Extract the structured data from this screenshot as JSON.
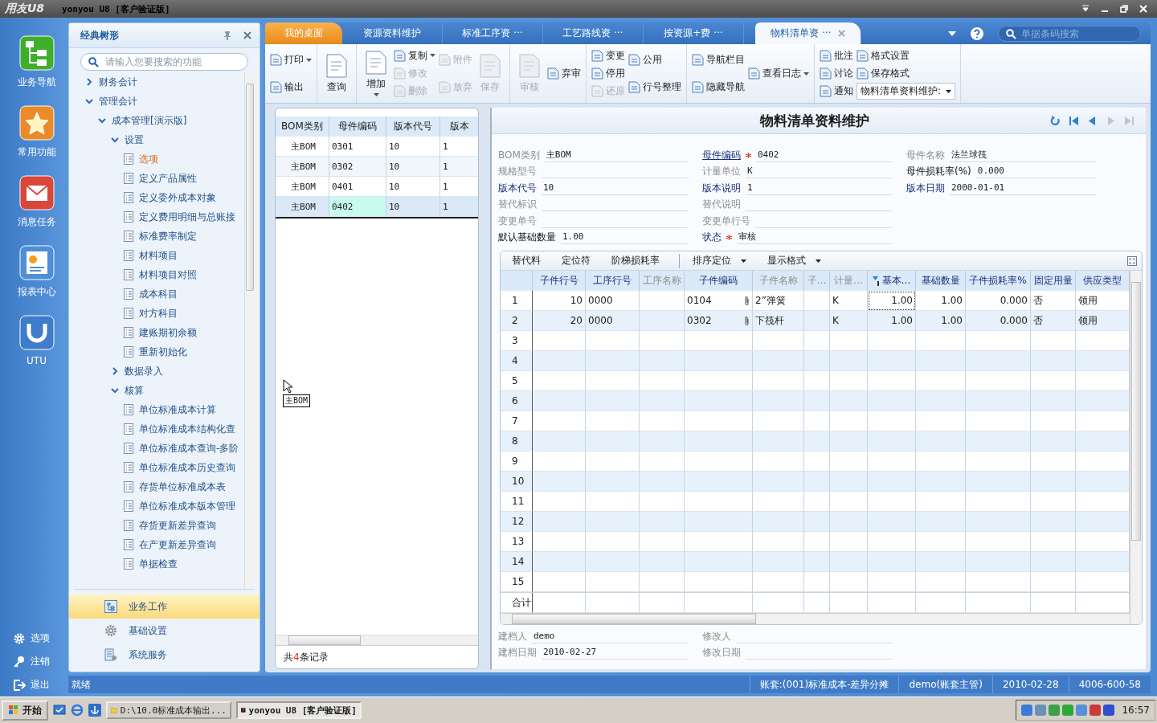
{
  "window": {
    "logo": "用友U8",
    "title": "yonyou U8 [客户验证版]"
  },
  "rail": {
    "items": [
      {
        "label": "业务导航"
      },
      {
        "label": "常用功能"
      },
      {
        "label": "消息任务"
      },
      {
        "label": "报表中心"
      },
      {
        "label": "UTU"
      }
    ],
    "bottom": [
      {
        "label": "选项"
      },
      {
        "label": "注销"
      },
      {
        "label": "退出"
      }
    ]
  },
  "tree_panel": {
    "title": "经典树形",
    "search": {
      "placeholder": "请输入您要搜索的功能"
    },
    "tree": [
      {
        "label": "财务会计",
        "kind": "folder",
        "expanded": false,
        "selected": false
      },
      {
        "label": "管理会计",
        "kind": "folder",
        "expanded": true,
        "selected": false,
        "children": [
          {
            "label": "成本管理[演示版]",
            "kind": "folder",
            "expanded": true,
            "selected": false,
            "children": [
              {
                "label": "设置",
                "kind": "folder",
                "expanded": true,
                "selected": false,
                "children": [
                  {
                    "label": "选项",
                    "kind": "leaf",
                    "selected": true
                  },
                  {
                    "label": "定义产品属性",
                    "kind": "leaf",
                    "selected": false
                  },
                  {
                    "label": "定义委外成本对象",
                    "kind": "leaf",
                    "selected": false
                  },
                  {
                    "label": "定义费用明细与总账接",
                    "kind": "leaf",
                    "selected": false
                  },
                  {
                    "label": "标准费率制定",
                    "kind": "leaf",
                    "selected": false
                  },
                  {
                    "label": "材料项目",
                    "kind": "leaf",
                    "selected": false
                  },
                  {
                    "label": "材料项目对照",
                    "kind": "leaf",
                    "selected": false
                  },
                  {
                    "label": "成本科目",
                    "kind": "leaf",
                    "selected": false
                  },
                  {
                    "label": "对方科目",
                    "kind": "leaf",
                    "selected": false
                  },
                  {
                    "label": "建账期初余额",
                    "kind": "leaf",
                    "selected": false
                  },
                  {
                    "label": "重新初始化",
                    "kind": "leaf",
                    "selected": false
                  }
                ]
              },
              {
                "label": "数据录入",
                "kind": "folder",
                "expanded": false,
                "selected": false
              },
              {
                "label": "核算",
                "kind": "folder",
                "expanded": true,
                "selected": false,
                "children": [
                  {
                    "label": "单位标准成本计算",
                    "kind": "leaf",
                    "selected": false
                  },
                  {
                    "label": "单位标准成本结构化查",
                    "kind": "leaf",
                    "selected": false
                  },
                  {
                    "label": "单位标准成本查询-多阶",
                    "kind": "leaf",
                    "selected": false
                  },
                  {
                    "label": "单位标准成本历史查询",
                    "kind": "leaf",
                    "selected": false
                  },
                  {
                    "label": "存货单位标准成本表",
                    "kind": "leaf",
                    "selected": false
                  },
                  {
                    "label": "单位标准成本版本管理",
                    "kind": "leaf",
                    "selected": false
                  },
                  {
                    "label": "存货更新差异查询",
                    "kind": "leaf",
                    "selected": false
                  },
                  {
                    "label": "在产更新差异查询",
                    "kind": "leaf",
                    "selected": false
                  },
                  {
                    "label": "单据检查",
                    "kind": "leaf",
                    "selected": false
                  }
                ]
              }
            ]
          }
        ]
      }
    ],
    "modules": [
      {
        "label": "业务工作",
        "selected": true
      },
      {
        "label": "基础设置",
        "selected": false
      },
      {
        "label": "系统服务",
        "selected": false
      }
    ]
  },
  "tabs": [
    {
      "label": "我的桌面",
      "kind": "home",
      "selected": false
    },
    {
      "label": "资源资料维护",
      "kind": "doc",
      "selected": false
    },
    {
      "label": "标准工序资 ···",
      "kind": "doc",
      "selected": false
    },
    {
      "label": "工艺路线资 ···",
      "kind": "doc",
      "selected": false
    },
    {
      "label": "按资源+费 ···",
      "kind": "doc",
      "selected": false
    },
    {
      "label": "物料清单资 ···",
      "kind": "doc",
      "selected": true
    }
  ],
  "barcode_search": {
    "placeholder": "单据条码搜索"
  },
  "toolbar": {
    "groups": [
      [
        [
          {
            "label": "打印",
            "kind": "small",
            "disabled": false,
            "dropdown": true
          },
          {
            "label": "输出",
            "kind": "small",
            "disabled": false,
            "dropdown": false
          }
        ]
      ],
      [
        [
          {
            "label": "查询",
            "kind": "large",
            "disabled": false,
            "dropdown": false
          }
        ]
      ],
      [
        [
          {
            "label": "增加",
            "kind": "large",
            "disabled": false,
            "dropdown": true
          }
        ],
        [
          {
            "label": "复制",
            "kind": "small",
            "disabled": false,
            "dropdown": true
          },
          {
            "label": "修改",
            "kind": "small",
            "disabled": true,
            "dropdown": false
          },
          {
            "label": "删除",
            "kind": "small",
            "disabled": true,
            "dropdown": false
          }
        ],
        [
          {
            "label": "附件",
            "kind": "small",
            "disabled": true,
            "dropdown": false
          },
          {
            "label": "放弃",
            "kind": "small",
            "disabled": true,
            "dropdown": false
          }
        ],
        [
          {
            "label": "保存",
            "kind": "large",
            "disabled": true,
            "dropdown": false
          }
        ]
      ],
      [
        [
          {
            "label": "审核",
            "kind": "large",
            "disabled": true,
            "dropdown": false
          }
        ],
        [
          {
            "label": "弃审",
            "kind": "small",
            "disabled": false,
            "dropdown": false
          }
        ]
      ],
      [
        [
          {
            "label": "变更",
            "kind": "small",
            "disabled": false,
            "dropdown": false
          },
          {
            "label": "停用",
            "kind": "small",
            "disabled": false,
            "dropdown": false
          },
          {
            "label": "还原",
            "kind": "small",
            "disabled": true,
            "dropdown": false
          }
        ],
        [
          {
            "label": "公用",
            "kind": "small",
            "disabled": false,
            "dropdown": false
          },
          {
            "label": "行号整理",
            "kind": "small",
            "disabled": false,
            "dropdown": false
          }
        ]
      ],
      [
        [
          {
            "label": "导航栏目",
            "kind": "small",
            "disabled": false,
            "dropdown": false
          },
          {
            "label": "隐藏导航",
            "kind": "small",
            "disabled": false,
            "dropdown": false
          }
        ],
        [
          {
            "label": "查看日志",
            "kind": "small",
            "disabled": false,
            "dropdown": true
          }
        ]
      ],
      [
        [
          {
            "label": "批注",
            "kind": "small",
            "disabled": false,
            "dropdown": false
          },
          {
            "label": "讨论",
            "kind": "small",
            "disabled": false,
            "dropdown": false
          },
          {
            "label": "通知",
            "kind": "small",
            "disabled": false,
            "dropdown": false
          }
        ],
        [
          {
            "label": "格式设置",
            "kind": "small",
            "disabled": false,
            "dropdown": false
          },
          {
            "label": "保存格式",
            "kind": "small",
            "disabled": false,
            "dropdown": false
          },
          {
            "label": "物料清单资料维护:",
            "kind": "select",
            "dropdown": true
          }
        ]
      ]
    ]
  },
  "bom_list": {
    "columns": [
      "BOM类别",
      "母件编码",
      "版本代号",
      "版本"
    ],
    "rows": [
      {
        "cells": [
          "主BOM",
          "0301",
          "10",
          "1"
        ],
        "selected": false
      },
      {
        "cells": [
          "主BOM",
          "0302",
          "10",
          "1"
        ],
        "selected": false
      },
      {
        "cells": [
          "主BOM",
          "0401",
          "10",
          "1"
        ],
        "selected": false
      },
      {
        "cells": [
          "主BOM",
          "0402",
          "10",
          "1"
        ],
        "selected": true
      }
    ],
    "drag_tooltip": "主BOM",
    "footer": "共**4**条记录"
  },
  "form": {
    "title": "物料清单资料维护",
    "record_nav": [
      {
        "kind": "refresh",
        "disabled": false
      },
      {
        "kind": "first",
        "disabled": false
      },
      {
        "kind": "prev",
        "disabled": false
      },
      {
        "kind": "next",
        "disabled": true
      },
      {
        "kind": "last",
        "disabled": true
      }
    ],
    "columns": [
      [
        {
          "label": "BOM类别",
          "kind": "readonly",
          "required": false,
          "value": "主BOM"
        },
        {
          "label": "规格型号",
          "kind": "readonly",
          "required": false
        },
        {
          "label": "版本代号",
          "kind": "key",
          "required": false,
          "value": "10"
        },
        {
          "label": "替代标识",
          "kind": "readonly",
          "required": false
        },
        {
          "label": "变更单号",
          "kind": "readonly",
          "required": false
        },
        {
          "label": "默认基础数量",
          "kind": "editable",
          "required": false,
          "value": "1.00"
        }
      ],
      [
        {
          "label": "母件编码",
          "kind": "link",
          "required": true,
          "value": "0402"
        },
        {
          "label": "计量单位",
          "kind": "readonly",
          "required": false,
          "value": "K"
        },
        {
          "label": "版本说明",
          "kind": "key",
          "required": false,
          "value": "1"
        },
        {
          "label": "替代说明",
          "kind": "readonly",
          "required": false
        },
        {
          "label": "变更单行号",
          "kind": "readonly",
          "required": false
        },
        {
          "label": "状态",
          "kind": "key",
          "required": true,
          "value": "审核"
        }
      ],
      [
        {
          "label": "母件名称",
          "kind": "readonly",
          "required": false,
          "value": "法兰球筏"
        },
        {
          "label": "母件损耗率(%)",
          "kind": "editable",
          "required": false,
          "value": "0.000"
        },
        {
          "label": "版本日期",
          "kind": "key",
          "required": false,
          "value": "2000-01-01"
        }
      ]
    ]
  },
  "grid": {
    "toolbar": {
      "left": [
        {
          "label": "替代料"
        },
        {
          "label": "定位符"
        },
        {
          "label": "阶梯损耗率"
        }
      ],
      "right": [
        {
          "label": "排序定位",
          "dropdown": true
        },
        {
          "label": "显示格式",
          "dropdown": true
        }
      ]
    },
    "columns": [
      {
        "label": "子件行号",
        "muted": false,
        "sorted": false
      },
      {
        "label": "工序行号",
        "muted": false,
        "sorted": false
      },
      {
        "label": "工序名称",
        "muted": true,
        "sorted": false
      },
      {
        "label": "子件编码",
        "muted": false,
        "sorted": false
      },
      {
        "label": "子件名称",
        "muted": true,
        "sorted": false
      },
      {
        "label": "子…",
        "muted": true,
        "sorted": false
      },
      {
        "label": "计量…",
        "muted": true,
        "sorted": false
      },
      {
        "label": "基本…",
        "muted": false,
        "sorted": true
      },
      {
        "label": "基础数量",
        "muted": false,
        "sorted": false
      },
      {
        "label": "子件损耗率%",
        "muted": false,
        "sorted": false
      },
      {
        "label": "固定用量",
        "muted": false,
        "sorted": false
      },
      {
        "label": "供应类型",
        "muted": false,
        "sorted": false
      }
    ],
    "rows": [
      {
        "number": "1",
        "attachment": true,
        "cells": [
          "10",
          "0000",
          null,
          "0104",
          "2”弹簧",
          null,
          "K",
          "1.00",
          "1.00",
          "0.000",
          "否",
          "领用"
        ]
      },
      {
        "number": "2",
        "attachment": true,
        "cells": [
          "20",
          "0000",
          null,
          "0302",
          "下筏杆",
          null,
          "K",
          "1.00",
          "1.00",
          "0.000",
          "否",
          "领用"
        ]
      },
      {
        "number": "3",
        "attachment": false
      },
      {
        "number": "4",
        "attachment": false
      },
      {
        "number": "5",
        "attachment": false
      },
      {
        "number": "6",
        "attachment": false
      },
      {
        "number": "7",
        "attachment": false
      },
      {
        "number": "8",
        "attachment": false
      },
      {
        "number": "9",
        "attachment": false
      },
      {
        "number": "10",
        "attachment": false
      },
      {
        "number": "11",
        "attachment": false
      },
      {
        "number": "12",
        "attachment": false
      },
      {
        "number": "13",
        "attachment": false
      },
      {
        "number": "14",
        "attachment": false
      },
      {
        "number": "15",
        "attachment": false
      }
    ],
    "total_label": "合计"
  },
  "footer_fields": [
    [
      {
        "label": "建档人",
        "value": "demo"
      },
      {
        "label": "建档日期",
        "value": "2010-02-27"
      }
    ],
    [
      {
        "label": "修改人"
      },
      {
        "label": "修改日期"
      }
    ]
  ],
  "status_bar": {
    "message": "就绪",
    "items": [
      "账套:(001)标准成本-差异分摊",
      "demo(账套主管)",
      "2010-02-28",
      "4006-600-58"
    ]
  },
  "taskbar": {
    "start": "开始",
    "tasks": [
      {
        "label": "D:\\10.0标准成本输出...",
        "selected": false
      },
      {
        "label": "yonyou U8 [客户验证版]",
        "selected": true
      }
    ],
    "clock": "16:57"
  }
}
